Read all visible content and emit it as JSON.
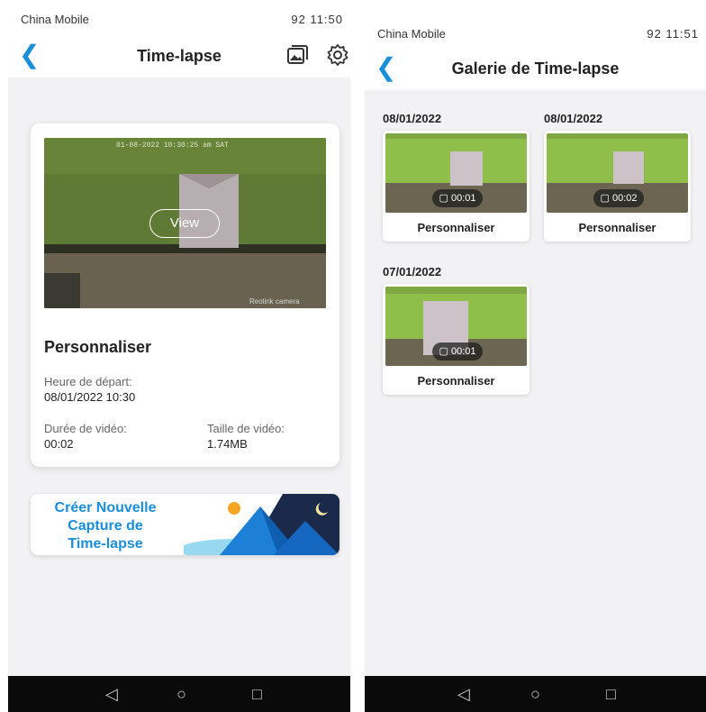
{
  "left": {
    "status": {
      "carrier": "China Mobile",
      "right": "92  11:50"
    },
    "header": {
      "title": "Time-lapse"
    },
    "card": {
      "view_label": "View",
      "title": "Personnaliser",
      "start_label": "Heure de départ:",
      "start_value": "08/01/2022 10:30",
      "duration_label": "Durée de vidéo:",
      "duration_value": "00:02",
      "size_label": "Taille de vidéo:",
      "size_value": "1.74MB",
      "overlay_timestamp": "01-08-2022 10:30:25 am SAT",
      "overlay_brand": "Reolink camera"
    },
    "banner": {
      "line1": "Créer Nouvelle",
      "line2": "Capture de",
      "line3": "Time-lapse"
    }
  },
  "right": {
    "status": {
      "carrier": "China Mobile",
      "right": "92  11:51"
    },
    "header": {
      "title": "Galerie de Time-lapse"
    },
    "groups": [
      {
        "date": "08/01/2022",
        "items": [
          {
            "duration": "00:01",
            "label": "Personnaliser"
          }
        ]
      },
      {
        "date": "08/01/2022",
        "items": [
          {
            "duration": "00:02",
            "label": "Personnaliser"
          }
        ]
      },
      {
        "date": "07/01/2022",
        "items": [
          {
            "duration": "00:01",
            "label": "Personnaliser"
          }
        ]
      }
    ]
  },
  "colors": {
    "accent": "#1a8fd9",
    "wall_green": "#7fb03a"
  },
  "icons": [
    "back-arrow-icon",
    "gallery-icon",
    "settings-gear-icon",
    "video-camera-icon",
    "nav-back-icon",
    "nav-home-icon",
    "nav-recent-icon"
  ]
}
